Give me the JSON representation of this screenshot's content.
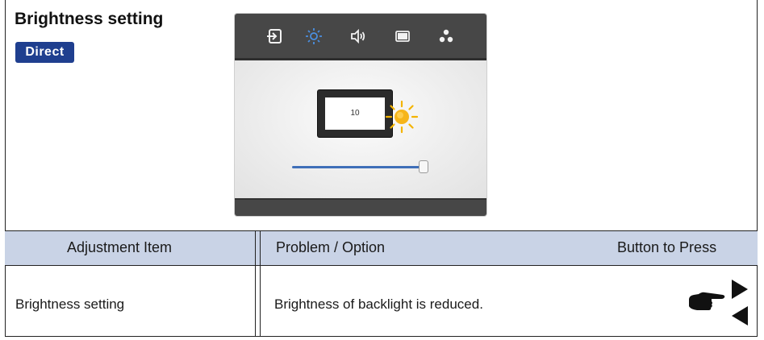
{
  "section": {
    "title": "Brightness setting",
    "badge": "Direct"
  },
  "osd": {
    "tab_icons": [
      "input-icon",
      "brightness-icon",
      "volume-icon",
      "screen-icon",
      "color-dots-icon"
    ],
    "active_tab": "brightness-icon",
    "brightness_value": "10",
    "slider_level": 1.0
  },
  "table": {
    "headers": {
      "item": "Adjustment Item",
      "problem": "Problem / Option",
      "button": "Button to Press"
    },
    "rows": [
      {
        "item": "Brightness setting",
        "problem": "Brightness of backlight is reduced.",
        "buttons": [
          "pointing-hand-icon",
          "right-arrow-icon",
          "left-arrow-icon"
        ]
      }
    ]
  },
  "colors": {
    "badge": "#1f3f8f",
    "header_bg": "#c9d3e6",
    "osd_dark": "#474747",
    "accent_blue": "#3f6fb8",
    "sun": "#f4b400"
  }
}
